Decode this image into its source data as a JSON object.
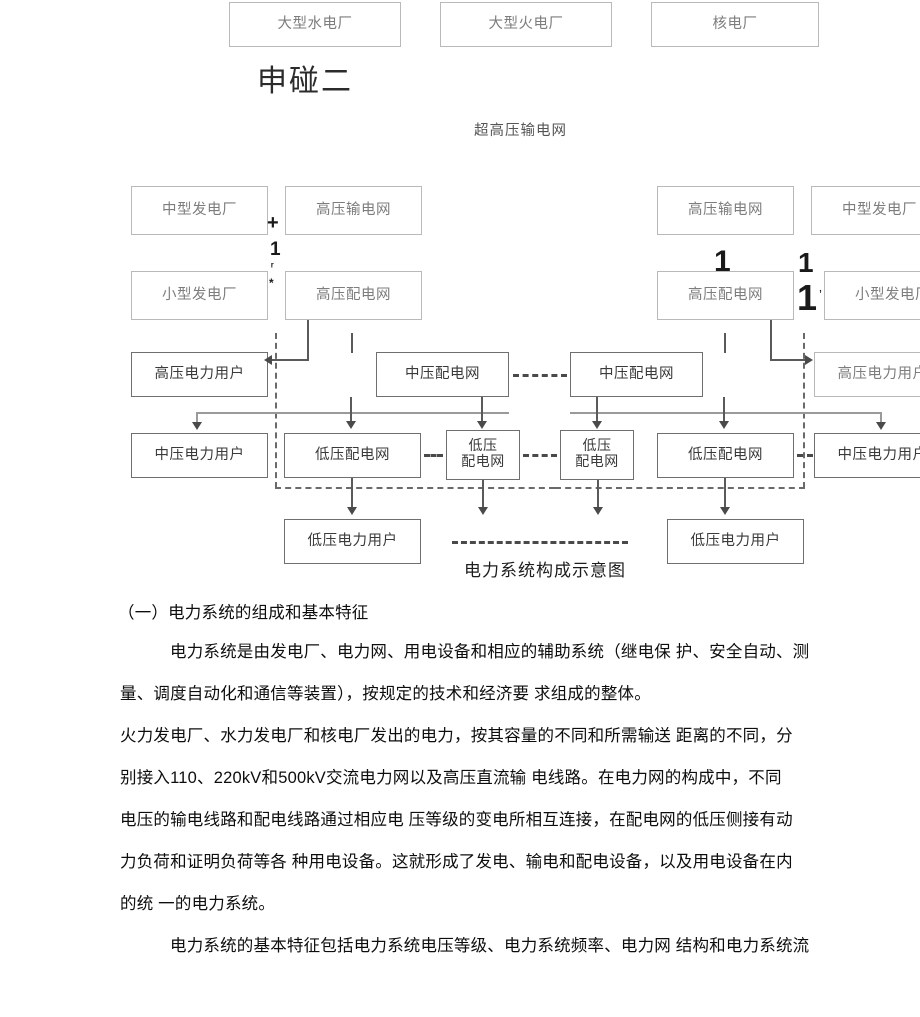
{
  "document": {
    "caption": "电力系统构成示意图",
    "ocr_artifact_title": "申碰二",
    "backbone_label": "超高压输电网"
  },
  "diagram": {
    "top_plants": [
      {
        "label": "大型水电厂"
      },
      {
        "label": "大型火电厂"
      },
      {
        "label": "核电厂"
      }
    ],
    "left_branch": {
      "medium_plant": "中型发电厂",
      "hv_transmission": "高压输电网",
      "small_plant": "小型发电厂",
      "hv_distribution": "高压配电网",
      "hv_consumer": "高压电力用户",
      "mv_distribution": "中压配电网",
      "mv_consumer": "中压电力用户",
      "lv_distribution": "低压配电网",
      "lv_distribution_small": "低压\n配电网",
      "lv_consumer": "低压电力用户"
    },
    "right_branch": {
      "medium_plant": "中型发电厂",
      "hv_transmission": "高压输电网",
      "small_plant": "小型发电厂",
      "hv_distribution": "高压配电网",
      "hv_consumer": "高压电力用户",
      "mv_distribution": "中压配电网",
      "mv_consumer": "中压电力用户",
      "lv_distribution": "低压配电网",
      "lv_distribution_small": "低压\n配电网",
      "lv_consumer": "低压电力用户"
    },
    "ocr_glyphs": {
      "plus": "+",
      "one_a": "1",
      "tick_r": "ʳ",
      "star": "*",
      "one_b": "1",
      "one_c": "1",
      "one_d": "1",
      "apostrophe": "’"
    },
    "colors": {
      "box_border_light": "#b9b9b9",
      "box_border_dark": "#6f6f6f",
      "box_text_light": "#7d7d7d",
      "box_text_dark": "#3a3a3a",
      "connector": "#5a5a5a",
      "boundary_dash": "#6a6a6a"
    }
  },
  "body": {
    "section_heading": "（一）电力系统的组成和基本特征",
    "paragraphs": [
      "电力系统是由发电厂、电力网、用电设备和相应的辅助系统（继电保  护、安全自动、测",
      "量、调度自动化和通信等装置），按规定的技术和经济要  求组成的整体。",
      "火力发电厂、水力发电厂和核电厂发出的电力，按其容量的不同和所需输送  距离的不同，分",
      "别接入110、220kV和500kV交流电力网以及高压直流输  电线路。在电力网的构成中，不同",
      "电压的输电线路和配电线路通过相应电  压等级的变电所相互连接，在配电网的低压侧接有动",
      "力负荷和证明负荷等各  种用电设备。这就形成了发电、输电和配电设备，以及用电设备在内",
      "的统  一的电力系统。",
      "电力系统的基本特征包括电力系统电压等级、电力系统频率、电力网  结构和电力系统流"
    ]
  }
}
